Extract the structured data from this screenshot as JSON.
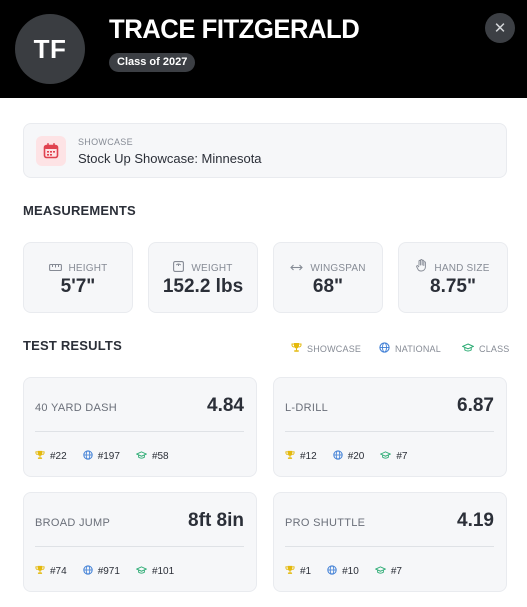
{
  "player": {
    "initials": "TF",
    "name": "TRACE FITZGERALD",
    "class_badge": "Class of 2027"
  },
  "header": {
    "close_icon": "close-icon"
  },
  "event": {
    "label": "SHOWCASE",
    "name": "Stock Up Showcase: Minnesota",
    "icon": "calendar-icon"
  },
  "measurements": {
    "title": "MEASUREMENTS",
    "items": [
      {
        "label": "HEIGHT",
        "value": "5'7\"",
        "icon": "ruler-icon"
      },
      {
        "label": "WEIGHT",
        "value": "152.2 lbs",
        "icon": "scale-icon"
      },
      {
        "label": "WINGSPAN",
        "value": "68\"",
        "icon": "arrows-horizontal-icon"
      },
      {
        "label": "HAND SIZE",
        "value": "8.75\"",
        "icon": "hand-icon"
      }
    ]
  },
  "test_results": {
    "title": "TEST RESULTS",
    "legend": [
      {
        "label": "SHOWCASE",
        "icon": "trophy-icon"
      },
      {
        "label": "NATIONAL",
        "icon": "globe-icon"
      },
      {
        "label": "CLASS",
        "icon": "graduation-cap-icon"
      }
    ],
    "tests": [
      {
        "name": "40 YARD DASH",
        "value": "4.84",
        "showcase_rank": "#22",
        "national_rank": "#197",
        "class_rank": "#58"
      },
      {
        "name": "L-DRILL",
        "value": "6.87",
        "showcase_rank": "#12",
        "national_rank": "#20",
        "class_rank": "#7"
      },
      {
        "name": "BROAD JUMP",
        "value": "8ft 8in",
        "showcase_rank": "#74",
        "national_rank": "#971",
        "class_rank": "#101"
      },
      {
        "name": "PRO SHUTTLE",
        "value": "4.19",
        "showcase_rank": "#1",
        "national_rank": "#10",
        "class_rank": "#7"
      }
    ]
  },
  "colors": {
    "header_bg": "#000000",
    "card_bg": "#f6f7f9",
    "trophy": "#e4b90c",
    "globe": "#3f7fd6",
    "cap": "#2bab73",
    "calendar": "#e0424f"
  }
}
